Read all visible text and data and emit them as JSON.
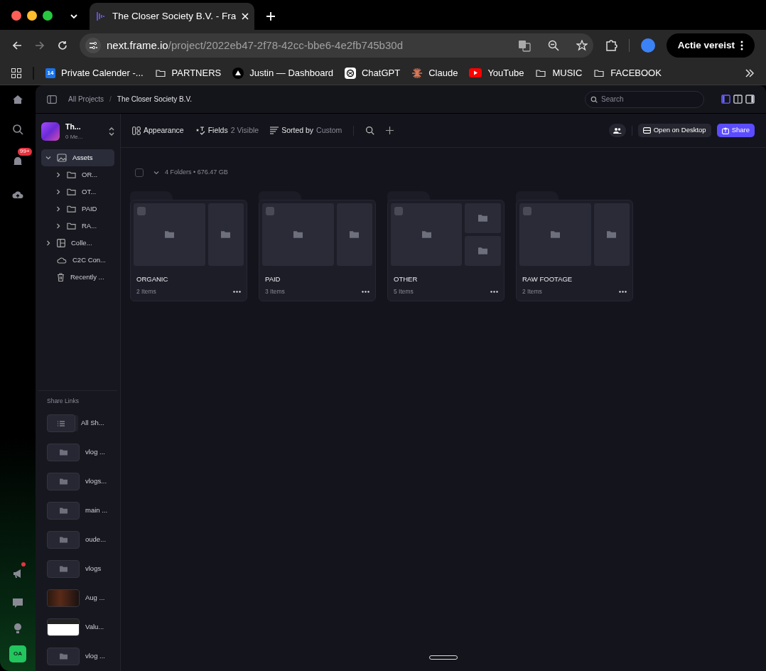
{
  "browser": {
    "tab_title": "The Closer Society B.V. - Fra",
    "url_host": "next.frame.io",
    "url_path": "/project/2022eb47-2f78-42cc-bbe6-4e2fb745b30d",
    "profile_button": "Actie vereist",
    "bookmarks": [
      {
        "label": "Private Calender -...",
        "kind": "calendar",
        "badge": "14"
      },
      {
        "label": "PARTNERS",
        "kind": "folder"
      },
      {
        "label": "Justin — Dashboard",
        "kind": "triangle"
      },
      {
        "label": "ChatGPT",
        "kind": "knot"
      },
      {
        "label": "Claude",
        "kind": "starburst"
      },
      {
        "label": "YouTube",
        "kind": "play"
      },
      {
        "label": "MUSIC",
        "kind": "folder"
      },
      {
        "label": "FACEBOOK",
        "kind": "folder"
      }
    ]
  },
  "rail": {
    "notification_badge": "99+",
    "avatar": "OA"
  },
  "topbar": {
    "breadcrumbs": [
      "All Projects",
      "The Closer Society B.V."
    ],
    "breadcrumb_separator": "/",
    "search": {
      "placeholder": "Search"
    },
    "views": [
      {
        "selected": true
      },
      {
        "selected": false
      },
      {
        "selected": false
      }
    ]
  },
  "sidebar": {
    "project": {
      "name": "Th...",
      "subtitle": "0 Me..."
    },
    "tree": [
      {
        "label": "Assets",
        "kind": "images",
        "expanded": true,
        "selected": true,
        "children": [
          {
            "label": "OR...",
            "kind": "folder",
            "expanded": false,
            "selected": false
          },
          {
            "label": "OT...",
            "kind": "folder",
            "expanded": false,
            "selected": false
          },
          {
            "label": "PAID",
            "kind": "folder",
            "expanded": false,
            "selected": false
          },
          {
            "label": "RA...",
            "kind": "folder",
            "expanded": false,
            "selected": false
          }
        ]
      },
      {
        "label": "Colle...",
        "kind": "collection",
        "expanded": false,
        "selected": false
      },
      {
        "label": "C2C Con...",
        "kind": "cloud",
        "selected": false
      },
      {
        "label": "Recently ...",
        "kind": "trash",
        "selected": false
      }
    ],
    "share_links_title": "Share Links",
    "share_links": [
      {
        "label": "All Sh...",
        "kind": "list"
      },
      {
        "label": "vlog ...",
        "kind": "folder"
      },
      {
        "label": "vlogs...",
        "kind": "folder"
      },
      {
        "label": "main ...",
        "kind": "folder"
      },
      {
        "label": "oude...",
        "kind": "folder"
      },
      {
        "label": "vlogs",
        "kind": "folder"
      },
      {
        "label": "Aug ...",
        "kind": "video"
      },
      {
        "label": "Valu...",
        "kind": "screenshot"
      },
      {
        "label": "vlog ...",
        "kind": "folder"
      }
    ]
  },
  "toolbar": {
    "appearance": "Appearance",
    "fields_label": "Fields",
    "fields_value": "2 Visible",
    "sort_label": "Sorted by",
    "sort_value": "Custom",
    "open_desktop": "Open on Desktop",
    "share": "Share"
  },
  "summary": "4 Folders • 676.47 GB",
  "select_all": {
    "checked": false
  },
  "folders": [
    {
      "name": "ORGANIC",
      "count": "2 Items",
      "kind": "pair",
      "checked": false
    },
    {
      "name": "PAID",
      "count": "3 Items",
      "kind": "pair",
      "checked": false
    },
    {
      "name": "OTHER",
      "count": "5 Items",
      "kind": "triple",
      "checked": false
    },
    {
      "name": "RAW FOOTAGE",
      "count": "2 Items",
      "kind": "pair",
      "checked": false
    }
  ]
}
